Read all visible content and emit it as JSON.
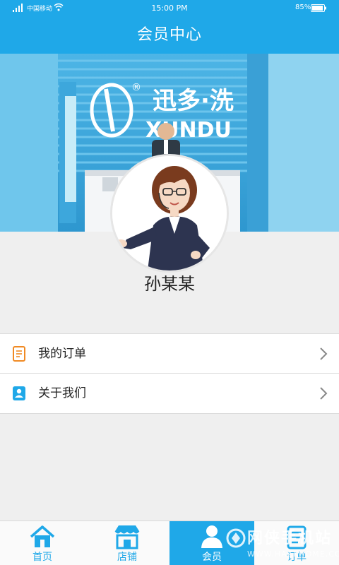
{
  "status_bar": {
    "carrier": "中国移动",
    "time": "15:00 PM",
    "battery": "85%"
  },
  "header": {
    "title": "会员中心"
  },
  "banner": {
    "brand_text": "迅多·洗",
    "brand_sub": "XUNDU"
  },
  "profile": {
    "username": "孙某某"
  },
  "menu": {
    "items": [
      {
        "label": "我的订单",
        "icon": "order-icon"
      },
      {
        "label": "关于我们",
        "icon": "about-icon"
      }
    ]
  },
  "tabbar": {
    "tabs": [
      {
        "label": "首页",
        "icon": "home-icon"
      },
      {
        "label": "店铺",
        "icon": "store-icon"
      },
      {
        "label": "会员",
        "icon": "member-icon",
        "active": true
      },
      {
        "label": "订单",
        "icon": "order-tab-icon"
      }
    ]
  },
  "watermark": {
    "text": "网侠手机站",
    "url": "WWW.HACKHOME.COM"
  },
  "colors": {
    "accent": "#1fa8e8",
    "background": "#efefef",
    "order_icon": "#f08a24",
    "about_icon": "#1fa8e8"
  }
}
